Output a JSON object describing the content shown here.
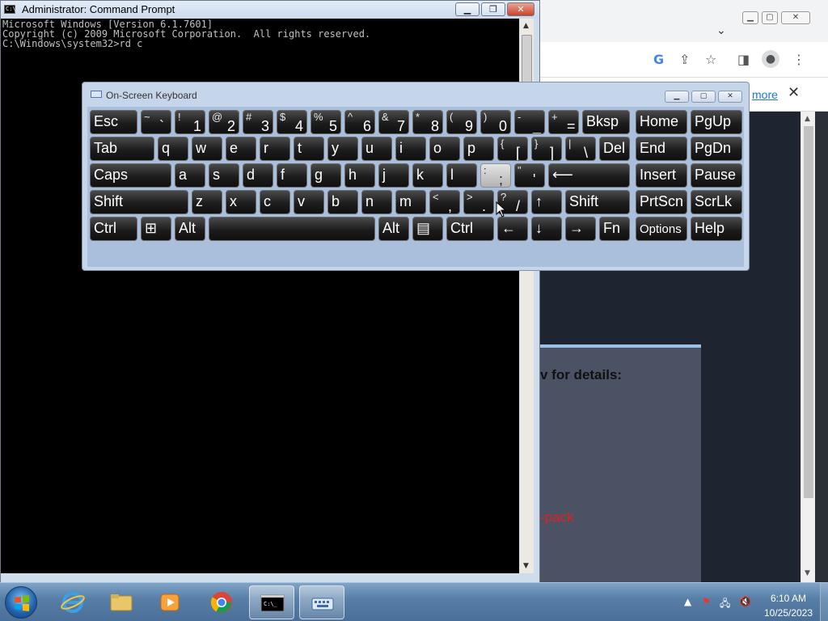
{
  "cmd": {
    "title": "Administrator: Command Prompt",
    "icon_text": "C:\\",
    "lines": [
      "Microsoft Windows [Version 6.1.7601]",
      "Copyright (c) 2009 Microsoft Corporation.  All rights reserved.",
      "",
      "C:\\Windows\\system32>rd c"
    ]
  },
  "chrome": {
    "infobar_link": "more",
    "dialog_text": "v for details:",
    "dialog_red_text": "-pack"
  },
  "osk": {
    "title": "On-Screen Keyboard",
    "rows": [
      [
        {
          "n": "esc",
          "l": "Esc"
        },
        {
          "n": "tilde",
          "s": "~",
          "m": "`"
        },
        {
          "n": "1",
          "s": "!",
          "m": "1"
        },
        {
          "n": "2",
          "s": "@",
          "m": "2"
        },
        {
          "n": "3",
          "s": "#",
          "m": "3"
        },
        {
          "n": "4",
          "s": "$",
          "m": "4"
        },
        {
          "n": "5",
          "s": "%",
          "m": "5"
        },
        {
          "n": "6",
          "s": "^",
          "m": "6"
        },
        {
          "n": "7",
          "s": "&",
          "m": "7"
        },
        {
          "n": "8",
          "s": "*",
          "m": "8"
        },
        {
          "n": "9",
          "s": "(",
          "m": "9"
        },
        {
          "n": "0",
          "s": ")",
          "m": "0"
        },
        {
          "n": "minus",
          "s": "-",
          "m": "_"
        },
        {
          "n": "equals",
          "s": "+",
          "m": "="
        },
        {
          "n": "backspace",
          "l": "Bksp"
        }
      ],
      [
        {
          "n": "tab",
          "l": "Tab"
        },
        {
          "n": "q",
          "l": "q"
        },
        {
          "n": "w",
          "l": "w"
        },
        {
          "n": "e",
          "l": "e"
        },
        {
          "n": "r",
          "l": "r"
        },
        {
          "n": "t",
          "l": "t"
        },
        {
          "n": "y",
          "l": "y"
        },
        {
          "n": "u",
          "l": "u"
        },
        {
          "n": "i",
          "l": "i"
        },
        {
          "n": "o",
          "l": "o"
        },
        {
          "n": "p",
          "l": "p"
        },
        {
          "n": "bracket-left",
          "s": "{",
          "m": "["
        },
        {
          "n": "bracket-right",
          "s": "}",
          "m": "]"
        },
        {
          "n": "backslash",
          "s": "|",
          "m": "\\"
        },
        {
          "n": "delete",
          "l": "Del"
        }
      ],
      [
        {
          "n": "caps",
          "l": "Caps"
        },
        {
          "n": "a",
          "l": "a"
        },
        {
          "n": "s",
          "l": "s"
        },
        {
          "n": "d",
          "l": "d"
        },
        {
          "n": "f",
          "l": "f"
        },
        {
          "n": "g",
          "l": "g"
        },
        {
          "n": "h",
          "l": "h"
        },
        {
          "n": "j",
          "l": "j"
        },
        {
          "n": "k",
          "l": "k"
        },
        {
          "n": "l",
          "l": "l"
        },
        {
          "n": "semicolon",
          "s": ":",
          "m": ";"
        },
        {
          "n": "quote",
          "s": "\"",
          "m": "'"
        },
        {
          "n": "enter",
          "l": "⟵"
        }
      ],
      [
        {
          "n": "shift-left",
          "l": "Shift"
        },
        {
          "n": "z",
          "l": "z"
        },
        {
          "n": "x",
          "l": "x"
        },
        {
          "n": "c",
          "l": "c"
        },
        {
          "n": "v",
          "l": "v"
        },
        {
          "n": "b",
          "l": "b"
        },
        {
          "n": "n",
          "l": "n"
        },
        {
          "n": "m",
          "l": "m"
        },
        {
          "n": "comma",
          "s": "<",
          "m": ","
        },
        {
          "n": "period",
          "s": ">",
          "m": "."
        },
        {
          "n": "slash",
          "s": "?",
          "m": "/"
        },
        {
          "n": "up",
          "l": "↑"
        },
        {
          "n": "shift-right",
          "l": "Shift"
        }
      ],
      [
        {
          "n": "ctrl-left",
          "l": "Ctrl"
        },
        {
          "n": "win",
          "l": "⊞"
        },
        {
          "n": "alt-left",
          "l": "Alt"
        },
        {
          "n": "space",
          "l": ""
        },
        {
          "n": "alt-right",
          "l": "Alt"
        },
        {
          "n": "menu",
          "l": "▤"
        },
        {
          "n": "ctrl-right",
          "l": "Ctrl"
        },
        {
          "n": "left",
          "l": "←"
        },
        {
          "n": "down",
          "l": "↓"
        },
        {
          "n": "right",
          "l": "→"
        },
        {
          "n": "fn",
          "l": "Fn"
        }
      ]
    ],
    "nav_keys": [
      [
        {
          "n": "home",
          "l": "Home"
        },
        {
          "n": "pgup",
          "l": "PgUp"
        }
      ],
      [
        {
          "n": "end",
          "l": "End"
        },
        {
          "n": "pgdn",
          "l": "PgDn"
        }
      ],
      [
        {
          "n": "insert",
          "l": "Insert"
        },
        {
          "n": "pause",
          "l": "Pause"
        }
      ],
      [
        {
          "n": "prtscn",
          "l": "PrtScn"
        },
        {
          "n": "scrlk",
          "l": "ScrLk"
        }
      ],
      [
        {
          "n": "options",
          "l": "Options"
        },
        {
          "n": "help",
          "l": "Help"
        }
      ]
    ],
    "highlighted_key": "semicolon"
  },
  "taskbar": {
    "apps": [
      "internet-explorer",
      "file-explorer",
      "media-player",
      "chrome",
      "command-prompt",
      "on-screen-keyboard"
    ],
    "active": [
      "command-prompt",
      "on-screen-keyboard"
    ],
    "time": "6:10 AM",
    "date": "10/25/2023"
  },
  "colors": {
    "console_bg": "#000000",
    "console_text": "#c0c0c0",
    "key_bg": "#1c1c1c",
    "osk_frame": "#c6d6ea",
    "taskbar": "#587fa7"
  }
}
